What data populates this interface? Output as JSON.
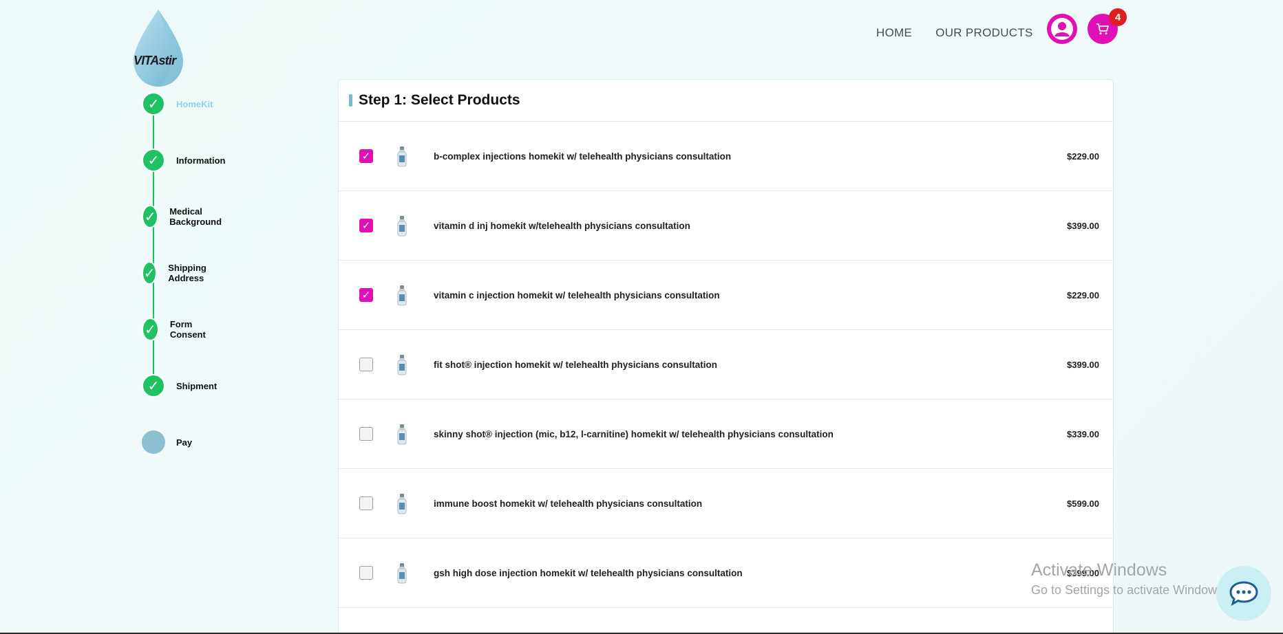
{
  "brand": {
    "logo_text": "VITAstir"
  },
  "nav": {
    "home": "HOME",
    "products": "OUR PRODUCTS"
  },
  "cart": {
    "count": "4"
  },
  "steps": [
    {
      "label": "HomeKit",
      "status": "active"
    },
    {
      "label": "Information",
      "status": "done"
    },
    {
      "label": "Medical Background",
      "status": "done"
    },
    {
      "label": "Shipping Address",
      "status": "done"
    },
    {
      "label": "Form Consent",
      "status": "done"
    },
    {
      "label": "Shipment",
      "status": "done"
    },
    {
      "label": "Pay",
      "status": "pending"
    }
  ],
  "panel": {
    "title": "Step 1: Select Products"
  },
  "products": [
    {
      "name": "b-complex injections homekit w/ telehealth physicians consultation",
      "price": "$229.00",
      "checked": true
    },
    {
      "name": "vitamin d inj homekit w/telehealth physicians consultation",
      "price": "$399.00",
      "checked": true
    },
    {
      "name": "vitamin c injection homekit w/ telehealth physicians consultation",
      "price": "$229.00",
      "checked": true
    },
    {
      "name": "fit shot® injection homekit w/ telehealth physicians consultation",
      "price": "$399.00",
      "checked": false
    },
    {
      "name": "skinny shot® injection (mic, b12, l-carnitine) homekit w/ telehealth physicians consultation",
      "price": "$339.00",
      "checked": false
    },
    {
      "name": "immune boost homekit w/ telehealth physicians consultation",
      "price": "$599.00",
      "checked": false
    },
    {
      "name": "gsh high dose injection homekit w/ telehealth physicians consultation",
      "price": "$399.00",
      "checked": false
    }
  ],
  "watermark": {
    "line1": "Activate Windows",
    "line2": "Go to Settings to activate Windows."
  },
  "colors": {
    "accent": "#e00fb6",
    "success": "#1fc262",
    "badge": "#e02020"
  },
  "icons": {
    "user": "user-icon",
    "cart": "cart-icon",
    "chat": "chat-icon",
    "check": "check-icon",
    "vial": "vial-icon"
  }
}
